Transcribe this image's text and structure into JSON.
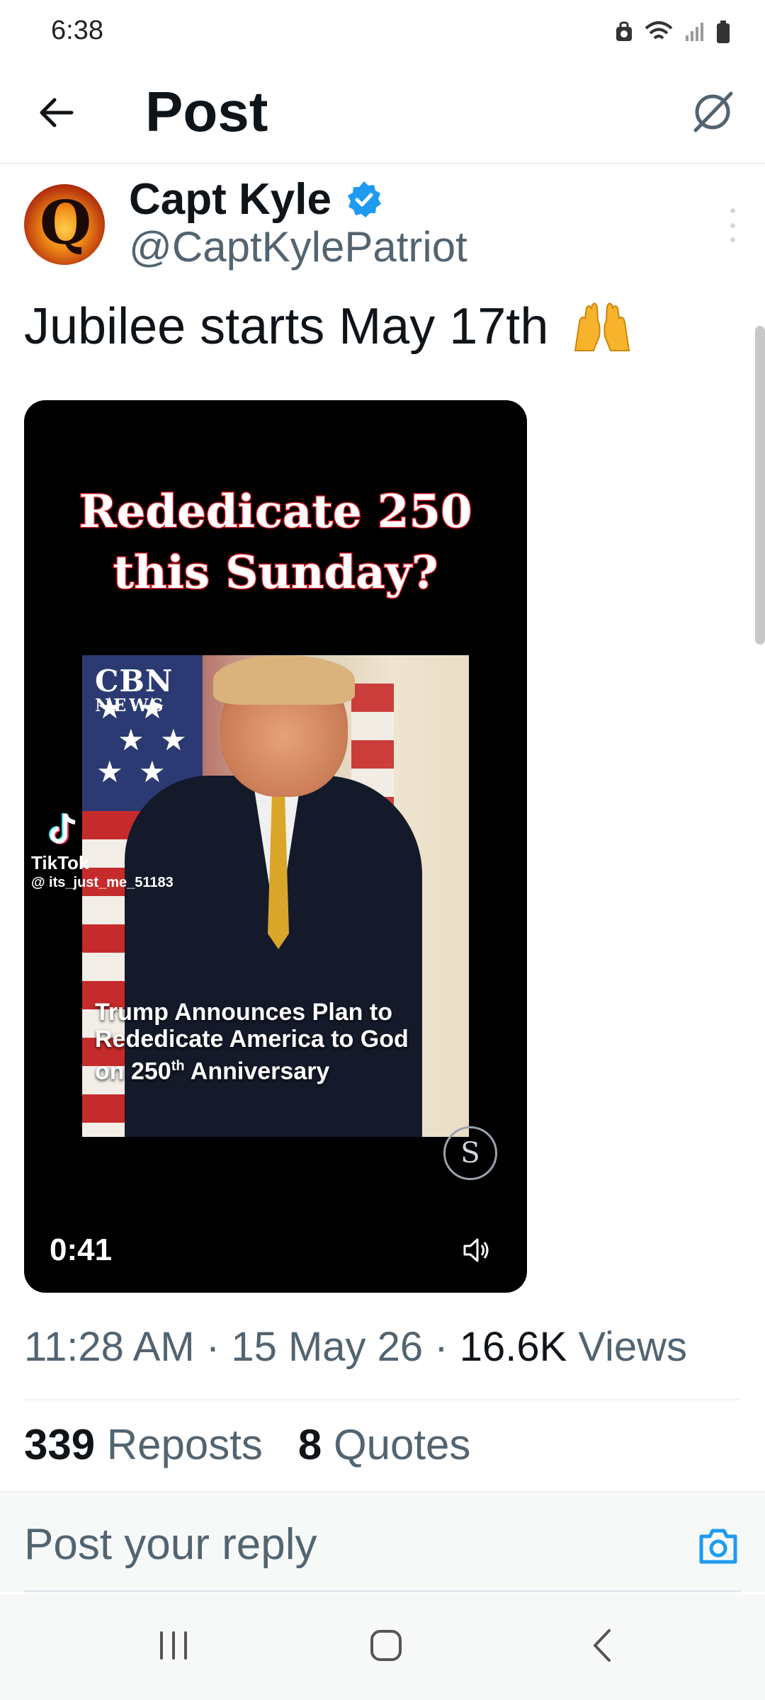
{
  "status_bar": {
    "time": "6:38"
  },
  "header": {
    "title": "Post"
  },
  "author": {
    "display_name": "Capt Kyle",
    "handle": "@CaptKylePatriot"
  },
  "post": {
    "text": "Jubilee starts May 17th"
  },
  "media": {
    "headline_line1": "Rededicate 250",
    "headline_line2": "this Sunday?",
    "logo_line1": "CBN",
    "logo_line2": "NEWS",
    "tiktok_label": "TikTok",
    "tiktok_user": "@ its_just_me_51183",
    "caption_line1": "Trump Announces Plan to",
    "caption_line2": "Rededicate America to God",
    "caption_line3_a": "on 250",
    "caption_line3_sup": "th",
    "caption_line3_b": " Anniversary",
    "watermark": "S",
    "duration": "0:41"
  },
  "meta": {
    "time": "11:28 AM",
    "date": "15 May 26",
    "views_count": "16.6K",
    "views_label": "Views"
  },
  "stats": {
    "reposts_count": "339",
    "reposts_label": "Reposts",
    "quotes_count": "8",
    "quotes_label": "Quotes"
  },
  "reply": {
    "placeholder": "Post your reply"
  },
  "colors": {
    "accent": "#1d9bf0",
    "text_primary": "#0f1419",
    "text_secondary": "#536471"
  }
}
